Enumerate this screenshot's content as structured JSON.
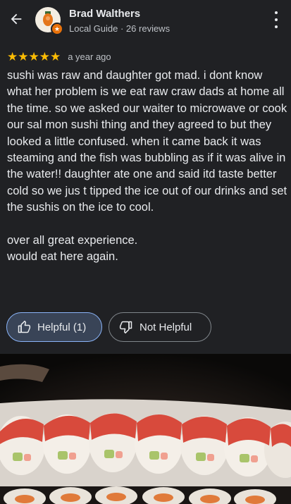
{
  "header": {
    "back_icon": "arrow-left-icon",
    "reviewer_name": "Brad Walthers",
    "reviewer_subtitle": "Local Guide · 26 reviews",
    "more_icon": "more-vert-icon"
  },
  "review": {
    "stars": "★★★★★",
    "rating": 5,
    "time_ago": "a year ago",
    "text": "sushi was raw and daughter got mad. i dont know what her problem is we eat raw craw dads at home all the time. so we asked our waiter to microwave or cook our sal mon sushi thing and they agreed to but they looked a little confused. when it came back it was steaming and the fish was bubbling as if it was alive in the water!! daughter ate one and said itd taste better cold so we jus t tipped the ice out of our drinks and set the sushis on the ice to cool.\n\nover all great experience.\nwould eat here again."
  },
  "actions": {
    "helpful_label": "Helpful (1)",
    "not_helpful_label": "Not Helpful"
  },
  "colors": {
    "background": "#202124",
    "star": "#fbbc04",
    "helpful_bg": "#394457",
    "accent_border": "#8ab4f8"
  }
}
